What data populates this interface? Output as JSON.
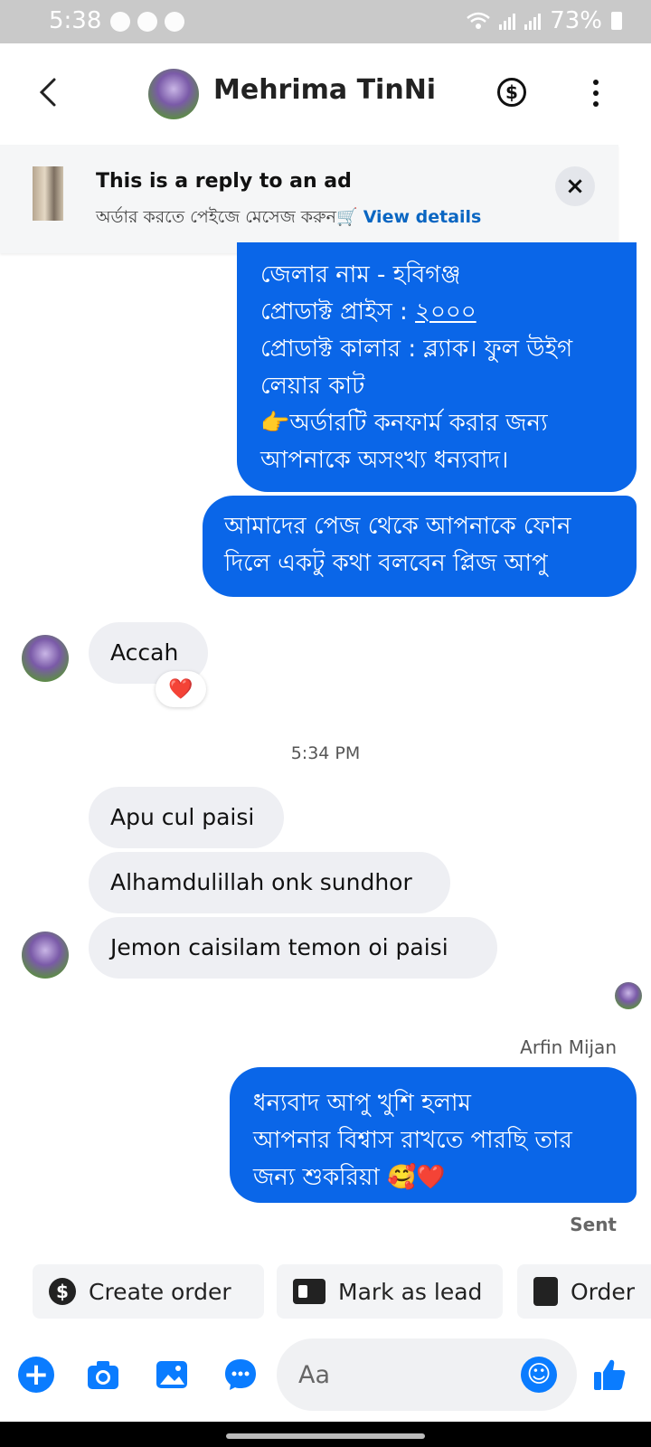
{
  "status_bar": {
    "time": "5:38",
    "battery": "73%"
  },
  "header": {
    "contact_name": "Mehrima TinNi",
    "payment_symbol": "$"
  },
  "ad_banner": {
    "title": "This is a reply to an ad",
    "subtitle": "অর্ডার করতে পেইজে মেসেজ করুন🛒",
    "link": "View details",
    "close_symbol": "×"
  },
  "messages": {
    "out_1": {
      "line1": "জেলার নাম - হবিগঞ্জ",
      "line2_prefix": "প্রোডাক্ট প্রাইস :",
      "line2_value": "২০০০",
      "line3": "প্রোডাক্ট কালার : ব্ল্যাক। ফুল উইগ",
      "line4": "লেয়ার কাট",
      "line5": "👉অর্ডারটি কনফার্ম করার জন্য",
      "line6": "আপনাকে অসংখ্য ধন্যবাদ।"
    },
    "out_2": {
      "line1": "আমাদের পেজ থেকে আপনাকে ফোন",
      "line2": "দিলে একটু কথা বলবেন প্লিজ আপু"
    },
    "in_1": {
      "text": "Accah",
      "reaction": "❤️"
    },
    "time_separator": "5:34 PM",
    "in_2": {
      "text": "Apu cul paisi"
    },
    "in_3": {
      "text": "Alhamdulillah onk sundhor"
    },
    "in_4": {
      "text": "Jemon caisilam temon oi paisi"
    },
    "sender_label": "Arfin Mijan",
    "out_3": {
      "line1": "ধন্যবাদ আপু খুশি হলাম",
      "line2": "আপনার বিশ্বাস রাখতে পারছি তার",
      "line3": "জন্য শুকরিয়া 🥰❤️"
    },
    "status": "Sent"
  },
  "quick_actions": {
    "create_order": "Create order",
    "mark_as_lead": "Mark as lead",
    "order": "Order"
  },
  "composer": {
    "placeholder": "Aa"
  }
}
